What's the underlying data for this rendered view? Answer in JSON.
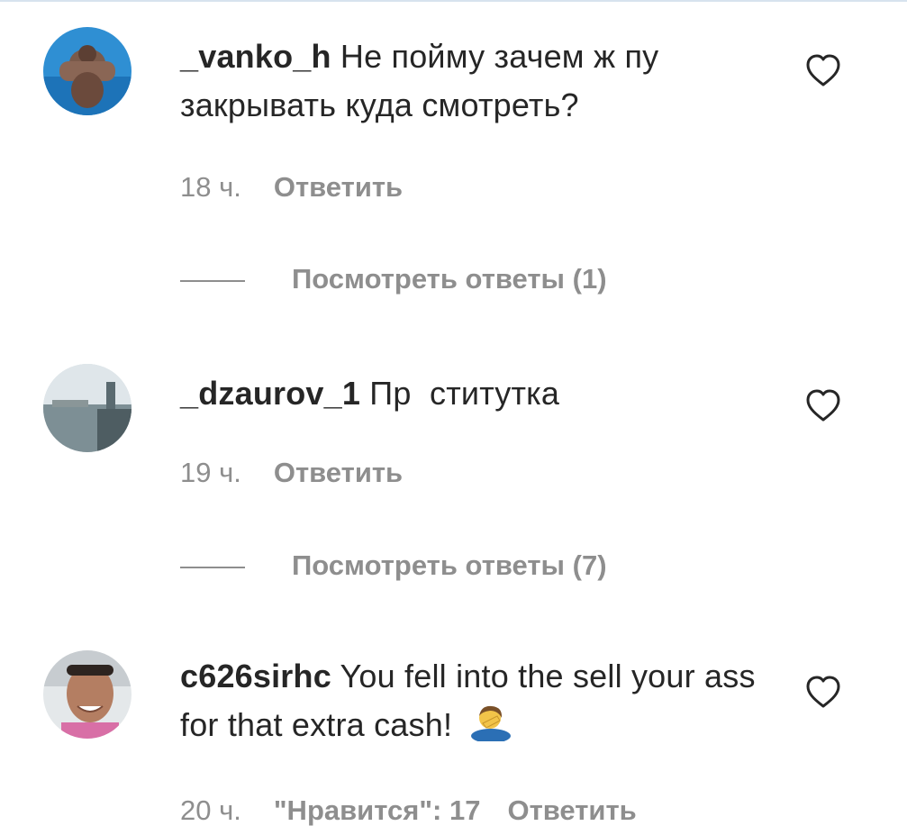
{
  "comments": [
    {
      "username": "_vanko_h",
      "text": "Не пойму зачем ж  пу закрывать куда смотреть?",
      "time": "18 ч.",
      "reply_label": "Ответить",
      "view_replies": "Посмотреть ответы (1)"
    },
    {
      "username": "_dzaurov_1",
      "text": "Пр  ститутка",
      "time": "19 ч.",
      "reply_label": "Ответить",
      "view_replies": "Посмотреть ответы (7)"
    },
    {
      "username": "c626sirhc",
      "text": "You fell into the sell your ass for that extra cash!",
      "emoji": "person-facepalming-emoji",
      "time": "20 ч.",
      "likes": "\"Нравится\": 17",
      "reply_label": "Ответить"
    }
  ],
  "colors": {
    "text": "#262626",
    "secondary": "#8e8e8e",
    "background": "#ffffff"
  }
}
